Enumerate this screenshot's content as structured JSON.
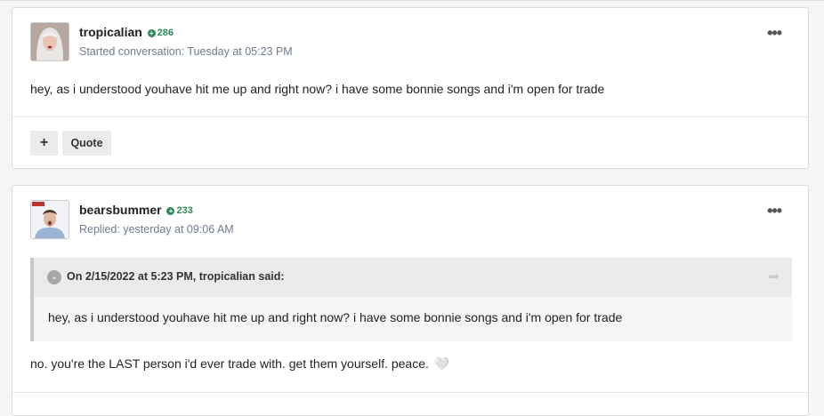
{
  "posts": [
    {
      "author": "tropicalian",
      "reputation": "286",
      "meta": "Started conversation: Tuesday at 05:23 PM",
      "body": "hey, as i understood youhave hit me up and right now? i have some bonnie songs and i'm open for trade",
      "menu_label": "•••",
      "actions": {
        "plus_label": "+",
        "quote_label": "Quote"
      }
    },
    {
      "author": "bearsbummer",
      "reputation": "233",
      "meta": "Replied: yesterday at 09:06 AM",
      "menu_label": "•••",
      "quote": {
        "citation": "On 2/15/2022 at 5:23 PM, tropicalian said:",
        "text": "hey, as i understood youhave hit me up and right now? i have some bonnie songs and i'm open for trade"
      },
      "body": "no. you're the LAST person i'd ever trade with. get them yourself. peace.",
      "emoji": "🤍"
    }
  ],
  "icons": {
    "reputation": "plus-circle-icon",
    "collapse": "chevron-down-icon",
    "share": "share-icon",
    "emoji": "white-heart-icon"
  },
  "colors": {
    "reputation": "#2d8a59",
    "meta": "#6f7c90",
    "quote_border": "#c8c8c8"
  }
}
